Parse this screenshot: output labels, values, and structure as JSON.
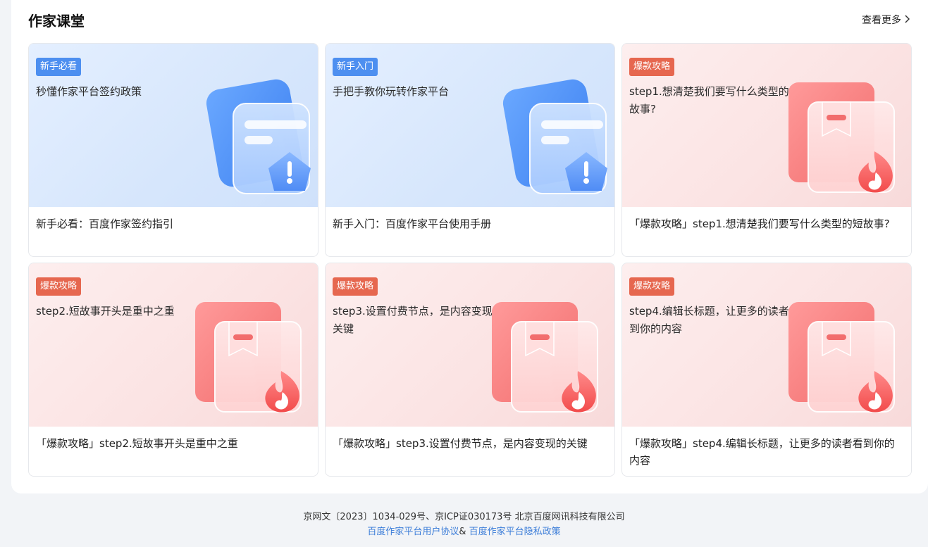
{
  "section": {
    "title": "作家课堂",
    "more_label": "查看更多"
  },
  "cards": [
    {
      "theme": "blue",
      "tag": "新手必看",
      "cover_text": "秒懂作家平台签约政策",
      "caption": "新手必看：百度作家签约指引",
      "illustration": "document-warning-icon"
    },
    {
      "theme": "blue",
      "tag": "新手入门",
      "cover_text": "手把手教你玩转作家平台",
      "caption": "新手入门：百度作家平台使用手册",
      "illustration": "document-warning-icon"
    },
    {
      "theme": "red",
      "tag": "爆款攻略",
      "cover_text": "step1.想清楚我们要写什么类型的短故事?",
      "caption": "「爆款攻略」step1.想清楚我们要写什么类型的短故事?",
      "illustration": "book-fire-icon"
    },
    {
      "theme": "red",
      "tag": "爆款攻略",
      "cover_text": "step2.短故事开头是重中之重",
      "caption": "「爆款攻略」step2.短故事开头是重中之重",
      "illustration": "book-fire-icon"
    },
    {
      "theme": "red",
      "tag": "爆款攻略",
      "cover_text": "step3.设置付费节点，是内容变现的关键",
      "caption": "「爆款攻略」step3.设置付费节点，是内容变现的关键",
      "illustration": "book-fire-icon"
    },
    {
      "theme": "red",
      "tag": "爆款攻略",
      "cover_text": "step4.编辑长标题，让更多的读者看到你的内容",
      "caption": "「爆款攻略」step4.编辑长标题，让更多的读者看到你的内容",
      "illustration": "book-fire-icon"
    }
  ],
  "footer": {
    "icp": "京网文〔2023〕1034-029号、京ICP证030173号 北京百度网讯科技有限公司",
    "user_agreement": "百度作家平台用户协议",
    "amp": "&",
    "privacy_policy": "百度作家平台隐私政策"
  },
  "colors": {
    "tag_blue": "#4d8ff0",
    "tag_red": "#e6674f",
    "link": "#3a7cd8"
  }
}
